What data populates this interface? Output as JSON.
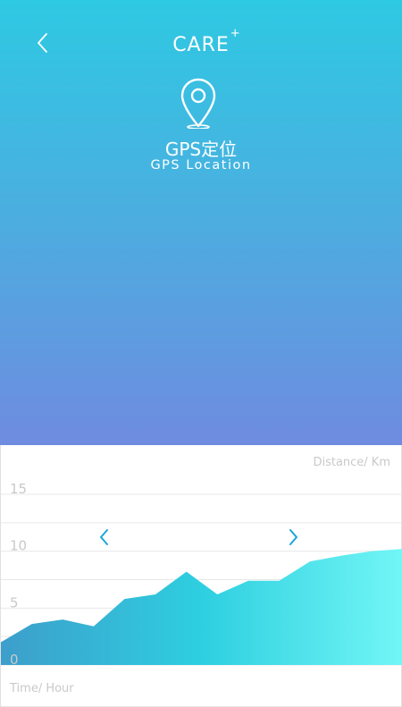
{
  "header": {
    "brand": "CARE",
    "brand_superscript": "+",
    "title_cn": "GPS定位",
    "title_en": "GPS  Location"
  },
  "icons": {
    "back": "chevron-left-icon",
    "location": "location-pin-icon",
    "prev": "chevron-left-icon",
    "next": "chevron-right-icon"
  },
  "colors": {
    "gradient_top": "#2ec9e3",
    "gradient_bottom": "#6f8be0",
    "area_left": "#3d9ecb",
    "area_mid": "#2ecfe0",
    "area_right": "#72f6f6",
    "arrow": "#1aa6d8",
    "grid": "#e8e8e8",
    "label": "#c9c9c9"
  },
  "chart_data": {
    "type": "area",
    "ylabel": "Distance/ Km",
    "xlabel": "Time/ Hour",
    "ylim": [
      0,
      15
    ],
    "yticks": [
      0,
      5,
      10,
      15
    ],
    "grid": true,
    "series": [
      {
        "x": [
          0,
          1,
          2,
          3,
          4,
          5,
          6,
          7,
          8,
          9,
          10,
          11,
          12,
          13
        ],
        "values": [
          2.0,
          3.6,
          4.0,
          3.4,
          5.8,
          6.2,
          8.2,
          6.2,
          7.4,
          7.4,
          9.1,
          9.6,
          10.0,
          10.2
        ]
      }
    ]
  }
}
